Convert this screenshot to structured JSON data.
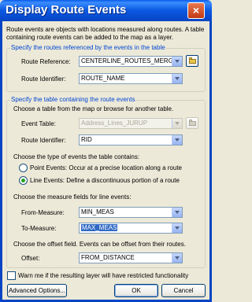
{
  "window": {
    "title": "Display Route Events",
    "close_glyph": "×"
  },
  "intro": {
    "line1": "Route events are objects with locations measured along routes. A table",
    "line2": "containing route events can be added to the map as a layer."
  },
  "routes_group": {
    "label": "Specify the routes referenced by the events in the table",
    "route_reference_label": "Route Reference:",
    "route_reference_value": "CENTERLINE_ROUTES_MERGED",
    "route_identifier_label": "Route Identifier:",
    "route_identifier_value": "ROUTE_NAME"
  },
  "events_group": {
    "label": "Specify the table containing the route events",
    "choose_table_text": "Choose a table from the map or browse for another table.",
    "event_table_label": "Event Table:",
    "event_table_value": "Address_Lines_JURUP",
    "route_identifier_label": "Route Identifier:",
    "route_identifier_value": "RID",
    "type_prompt": "Choose the type of events the table contains:",
    "point_events_label": "Point Events: Occur at a precise location along a route",
    "line_events_label": "Line Events: Define a discontinuous portion of a route",
    "selected_type": "line",
    "measure_prompt": "Choose the measure fields for line events:",
    "from_measure_label": "From-Measure:",
    "from_measure_value": "MIN_MEAS",
    "to_measure_label": "To-Measure:",
    "to_measure_value": "MAX_MEAS",
    "offset_prompt": "Choose the offset field. Events can be offset from their routes.",
    "offset_label": "Offset:",
    "offset_value": "FROM_DISTANCE"
  },
  "warn_checkbox_label": "Warn me if the resulting layer will have restricted functionality",
  "warn_checked": false,
  "buttons": {
    "advanced": "Advanced Options...",
    "ok": "OK",
    "cancel": "Cancel"
  },
  "colors": {
    "title_bar": "#0a58e0",
    "group_label": "#0046d5",
    "selection": "#316ac5",
    "dialog_bg": "#ece9d8"
  }
}
